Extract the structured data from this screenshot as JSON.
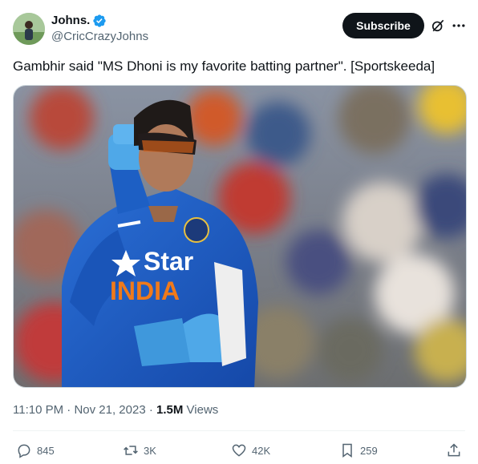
{
  "author": {
    "display_name": "Johns.",
    "handle": "@CricCrazyJohns",
    "verified_icon": "verified-badge-icon",
    "avatar": "avatar-photo"
  },
  "header": {
    "subscribe_label": "Subscribe",
    "grok_icon": "grok-icon",
    "more_icon": "more-icon"
  },
  "tweet": {
    "text": "Gambhir said \"MS Dhoni is my favorite batting partner\". [Sportskeeda]",
    "media": {
      "jersey_brand": "Star",
      "jersey_team": "INDIA"
    }
  },
  "meta": {
    "time": "11:10 PM",
    "separator": "·",
    "date": "Nov 21, 2023",
    "separator2": "·",
    "views_count": "1.5M",
    "views_label": "Views"
  },
  "actions": {
    "replies": "845",
    "reposts": "3K",
    "likes": "42K",
    "bookmarks": "259"
  },
  "colors": {
    "accent": "#1d9bf0",
    "text": "#0f1419",
    "secondary": "#536471",
    "jersey": "#1f63c8"
  }
}
